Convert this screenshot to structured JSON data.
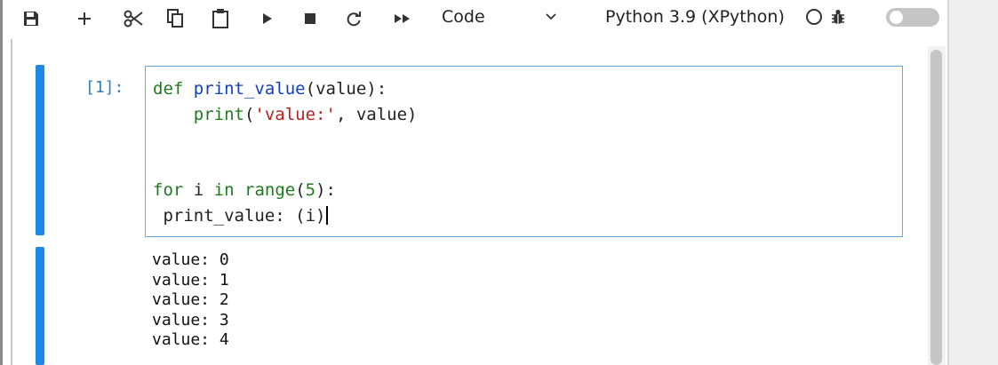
{
  "toolbar": {
    "buttons": [
      {
        "icon": "save-icon",
        "label": "Save"
      },
      {
        "icon": "plus-icon",
        "label": "Insert cell"
      },
      {
        "icon": "scissors-icon",
        "label": "Cut"
      },
      {
        "icon": "copy-icon",
        "label": "Copy"
      },
      {
        "icon": "paste-icon",
        "label": "Paste"
      },
      {
        "icon": "run-icon",
        "label": "Run"
      },
      {
        "icon": "stop-icon",
        "label": "Interrupt"
      },
      {
        "icon": "restart-icon",
        "label": "Restart"
      },
      {
        "icon": "fast-forward-icon",
        "label": "Run all"
      }
    ],
    "cell_type": "Code",
    "kernel_name": "Python 3.9 (XPython)",
    "kernel_status": "idle",
    "debugger_enabled": false
  },
  "cell": {
    "prompt": "[1]:",
    "code": {
      "line1": {
        "kw": "def",
        "name": "print_value",
        "rest": "(value):"
      },
      "line2": {
        "indent": "    ",
        "fn": "print",
        "open": "(",
        "str": "'value:'",
        "rest": ", value)"
      },
      "line3": {
        "kw1": "for",
        "mid1": " i ",
        "kw2": "in",
        "sp": " ",
        "fn": "range",
        "open": "(",
        "num": "5",
        "close": "):"
      },
      "line4": {
        "text": " print_value: (i)"
      }
    },
    "output": [
      "value: 0",
      "value: 1",
      "value: 2",
      "value: 3",
      "value: 4"
    ]
  },
  "colors": {
    "accent": "#1e88e5",
    "keyword": "#1f7a1f",
    "function_name": "#1040c0",
    "string": "#ba2121",
    "prompt": "#307fc1"
  }
}
